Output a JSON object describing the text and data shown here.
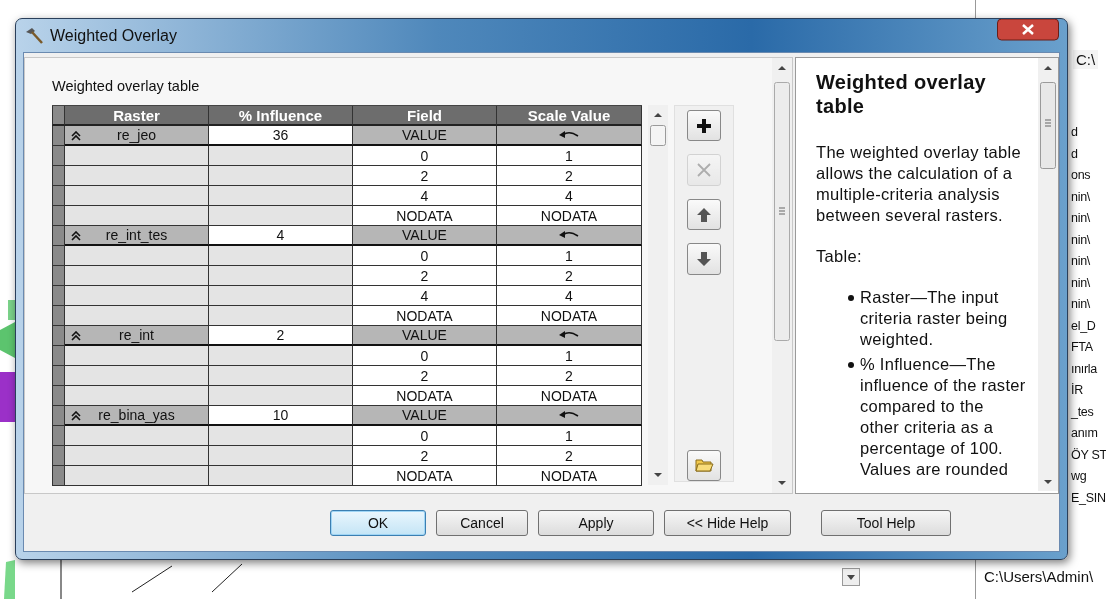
{
  "window": {
    "title": "Weighted Overlay"
  },
  "table_label": "Weighted overlay table",
  "table": {
    "columns": [
      "Raster",
      "% Influence",
      "Field",
      "Scale Value"
    ],
    "rasters": [
      {
        "name": "re_jeo",
        "influence": "36",
        "expanded": true,
        "field": "VALUE",
        "rows": [
          {
            "field": "0",
            "scale": "1"
          },
          {
            "field": "2",
            "scale": "2"
          },
          {
            "field": "4",
            "scale": "4"
          },
          {
            "field": "NODATA",
            "scale": "NODATA"
          }
        ]
      },
      {
        "name": "re_int_tes",
        "influence": "4",
        "expanded": true,
        "field": "VALUE",
        "rows": [
          {
            "field": "0",
            "scale": "1"
          },
          {
            "field": "2",
            "scale": "2"
          },
          {
            "field": "4",
            "scale": "4"
          },
          {
            "field": "NODATA",
            "scale": "NODATA"
          }
        ]
      },
      {
        "name": "re_int",
        "influence": "2",
        "expanded": true,
        "field": "VALUE",
        "rows": [
          {
            "field": "0",
            "scale": "1"
          },
          {
            "field": "2",
            "scale": "2"
          },
          {
            "field": "NODATA",
            "scale": "NODATA"
          }
        ]
      },
      {
        "name": "re_bina_yas",
        "influence": "10",
        "expanded": true,
        "field": "VALUE",
        "rows": [
          {
            "field": "0",
            "scale": "1"
          },
          {
            "field": "2",
            "scale": "2"
          },
          {
            "field": "NODATA",
            "scale": "NODATA"
          }
        ]
      }
    ]
  },
  "side_buttons": [
    {
      "kind": "add",
      "disabled": false
    },
    {
      "kind": "remove",
      "disabled": true
    },
    {
      "kind": "up",
      "disabled": false
    },
    {
      "kind": "down",
      "disabled": false
    },
    {
      "kind": "open",
      "disabled": false
    }
  ],
  "help": {
    "title": "Weighted overlay table",
    "paragraph": "The weighted overlay table allows the calculation of a multiple-criteria analysis between several rasters.",
    "heading": "Table:",
    "bullets": [
      "Raster—The input criteria raster being weighted.",
      "% Influence—The influence of the raster compared to the other criteria as a percentage of 100. Values are rounded"
    ]
  },
  "buttons": [
    {
      "label": "OK",
      "default": true
    },
    {
      "label": "Cancel",
      "default": false
    },
    {
      "label": "Apply",
      "default": false
    },
    {
      "label": "<< Hide Help",
      "default": false
    },
    {
      "label": "Tool Help",
      "default": false
    }
  ],
  "background": {
    "top_path": "C:\\",
    "items": [
      "d",
      "d",
      "ons",
      "nin\\",
      "nin\\",
      "nin\\",
      "nin\\",
      "nin\\",
      "nin\\",
      "el_D",
      "FTA",
      "ınırla",
      "İR",
      "_tes",
      "anım",
      "ÖY ST",
      "wg",
      "E_SIN"
    ],
    "bottom_path": "C:\\Users\\Admin\\"
  }
}
